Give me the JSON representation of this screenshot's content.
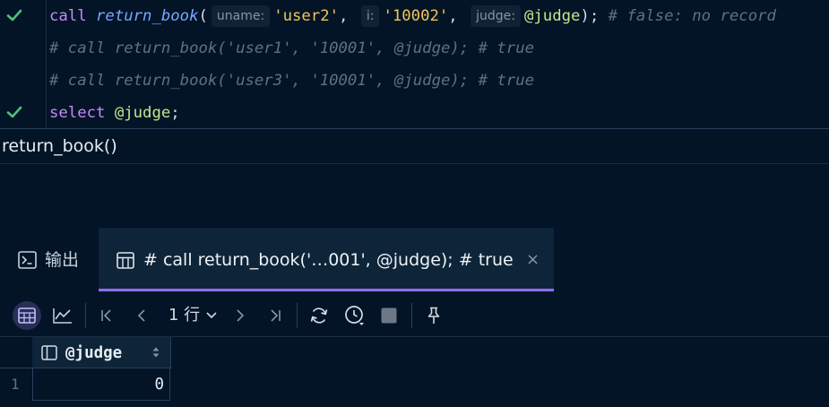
{
  "editor": {
    "line1": {
      "call": "call",
      "fn": "return_book",
      "open": "(",
      "hint_uname": "uname:",
      "arg1": "'user2'",
      "comma1": ",",
      "hint_i": "i:",
      "arg2": "'10002'",
      "comma2": ",",
      "hint_judge": "judge:",
      "arg3": "@judge",
      "close": ");",
      "comment": "# false: no record"
    },
    "line2": "# call return_book('user1', '10001', @judge); # true",
    "line3": "# call return_book('user3', '10001', @judge); # true",
    "line4": {
      "kw": "select",
      "var": "@judge",
      "semi": ";"
    }
  },
  "query_title": "return_book()",
  "tabs": {
    "output_label": "输出",
    "result_label": "# call return_book('…001', @judge); # true",
    "close_glyph": "×"
  },
  "toolbar": {
    "rows_label": "1 行"
  },
  "grid": {
    "columns": [
      "@judge"
    ],
    "rows": [
      {
        "index": "1",
        "values": [
          "0"
        ]
      }
    ]
  },
  "colors": {
    "background": "#021426",
    "keyword": "#c58af9",
    "function": "#79a6ff",
    "string": "#f2c55c",
    "variable": "#c3e88d",
    "comment": "#5e7185",
    "accent": "#8b6cf0",
    "success": "#4fc27a"
  }
}
